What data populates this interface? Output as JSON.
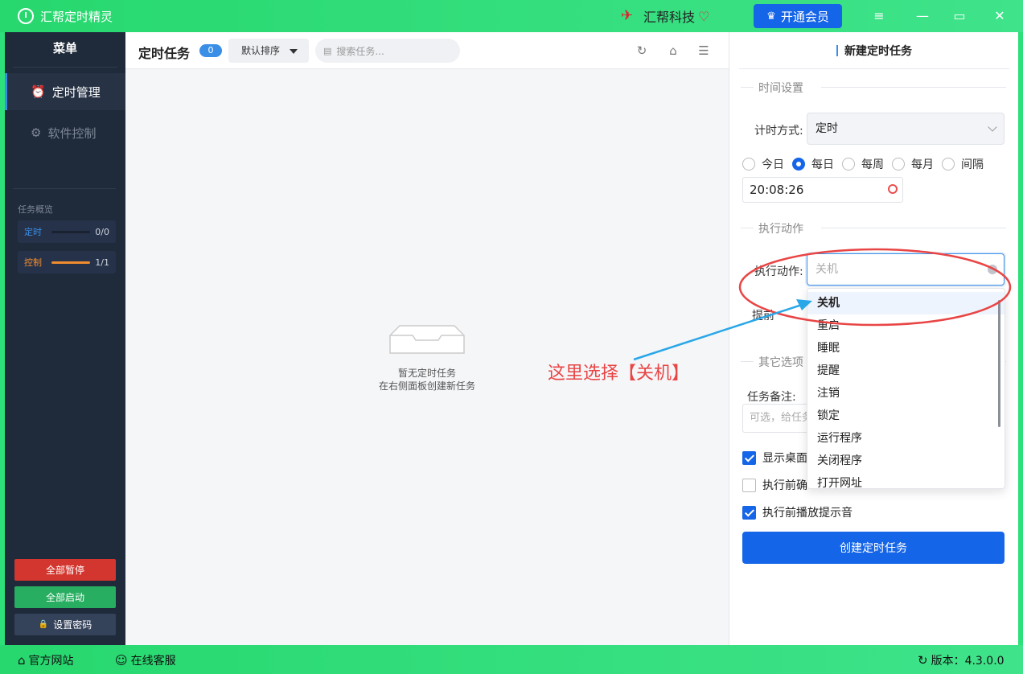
{
  "window": {
    "title": "汇帮定时精灵",
    "brand": "汇帮科技",
    "vip_button": "开通会员"
  },
  "sidebar": {
    "menu_title": "菜单",
    "items": [
      {
        "label": "定时管理",
        "icon": "alarm-clock-icon",
        "active": true
      },
      {
        "label": "软件控制",
        "icon": "gear-icon",
        "active": false
      }
    ],
    "overview_label": "任务概览",
    "overview": [
      {
        "label": "定时",
        "value": "0/0",
        "progress": 0,
        "color": "#3a8ee6"
      },
      {
        "label": "控制",
        "value": "1/1",
        "progress": 1,
        "color": "#f08c2e"
      }
    ],
    "buttons": {
      "pause_all": "全部暂停",
      "start_all": "全部启动",
      "set_password": "设置密码"
    }
  },
  "main": {
    "title": "定时任务",
    "count": "0",
    "sort_label": "默认排序",
    "search_placeholder": "搜索任务...",
    "empty_line1": "暂无定时任务",
    "empty_line2": "在右侧面板创建新任务"
  },
  "panel": {
    "title": "新建定时任务",
    "time_section": "时间设置",
    "timing_mode_label": "计时方式:",
    "timing_mode_value": "定时",
    "radios": [
      {
        "label": "今日",
        "checked": false
      },
      {
        "label": "每日",
        "checked": true
      },
      {
        "label": "每周",
        "checked": false
      },
      {
        "label": "每月",
        "checked": false
      },
      {
        "label": "间隔",
        "checked": false
      }
    ],
    "time_value": "20:08:26",
    "action_section": "执行动作",
    "action_label": "执行动作:",
    "action_placeholder": "关机",
    "advance_label": "提前",
    "other_section": "其它选项",
    "note_label": "任务备注:",
    "note_placeholder": "可选，给任务",
    "checks": [
      {
        "label": "显示桌面",
        "checked": true
      },
      {
        "label": "执行前确",
        "checked": false
      },
      {
        "label": "执行前播放提示音",
        "checked": true
      }
    ],
    "create_button": "创建定时任务"
  },
  "dropdown": {
    "options": [
      "关机",
      "重启",
      "睡眠",
      "提醒",
      "注销",
      "锁定",
      "运行程序",
      "关闭程序",
      "打开网址"
    ],
    "selected": "关机"
  },
  "annotation": {
    "text": "这里选择【关机】",
    "color": "#e94545",
    "arrow_color": "#2aa7e8"
  },
  "bottombar": {
    "website": "官方网站",
    "support": "在线客服",
    "version": "版本：4.3.0.0"
  }
}
